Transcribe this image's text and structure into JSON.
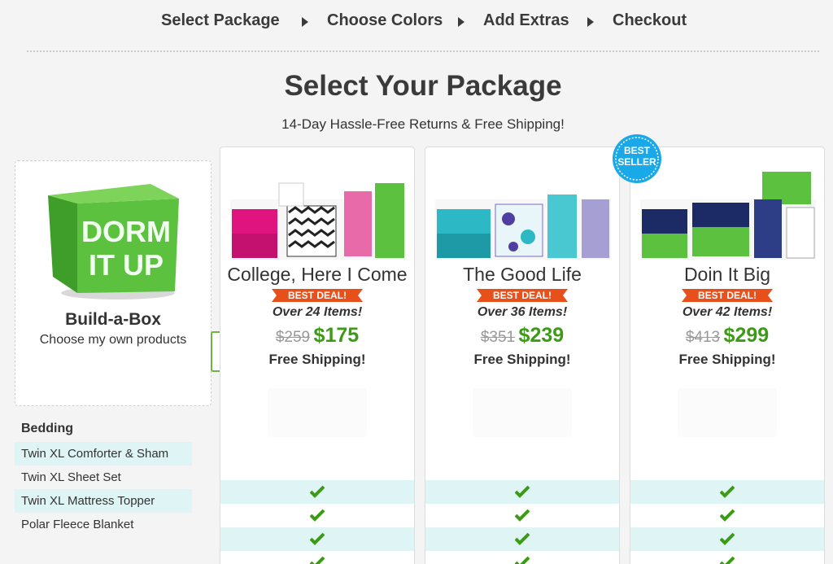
{
  "steps": [
    "Select Package",
    "Choose Colors",
    "Add Extras",
    "Checkout"
  ],
  "page_title": "Select Your Package",
  "subtitle": "14-Day Hassle-Free Returns & Free Shipping!",
  "build_box": {
    "logo_text_1": "DORM",
    "logo_text_2": "IT UP",
    "title": "Build-a-Box",
    "subtitle": "Choose my own products"
  },
  "features": {
    "heading": "Bedding",
    "items": [
      "Twin XL Comforter & Sham",
      "Twin XL Sheet Set",
      "Twin XL Mattress Topper",
      "Polar Fleece Blanket"
    ]
  },
  "badge": {
    "line1": "BEST",
    "line2": "SELLER",
    "color": "#1aa9e8"
  },
  "packages": [
    {
      "name": "College, Here I Come",
      "deal": "BEST DEAL!",
      "items": "Over 24 Items!",
      "old_price": "$259",
      "price": "$175",
      "shipping": "Free Shipping!",
      "accent": "#e0147f"
    },
    {
      "name": "The Good Life",
      "deal": "BEST DEAL!",
      "items": "Over 36 Items!",
      "old_price": "$351",
      "price": "$239",
      "shipping": "Free Shipping!",
      "accent": "#2cb8c4"
    },
    {
      "name": "Doin It Big",
      "deal": "BEST DEAL!",
      "items": "Over 42 Items!",
      "old_price": "$413",
      "price": "$299",
      "shipping": "Free Shipping!",
      "accent": "#1c2a66"
    }
  ],
  "colors": {
    "green": "#3c9b15",
    "deal": "#e8501b",
    "row_shade": "#dff4f5"
  }
}
